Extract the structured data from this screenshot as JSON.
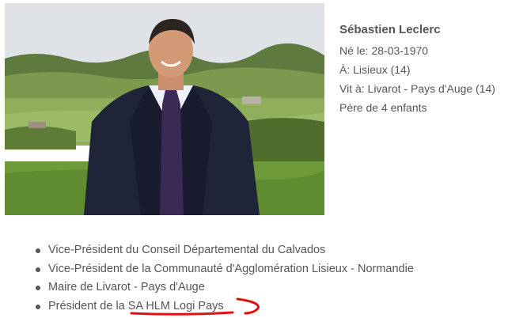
{
  "photo": {
    "alt": "Sébastien Leclerc portrait"
  },
  "bio": {
    "name": "Sébastien Leclerc",
    "born_on": "Né le: 28-03-1970",
    "born_in": "À: Lisieux (14)",
    "lives_in": "Vit à: Livarot - Pays d'Auge (14)",
    "family": "Père de 4 enfants"
  },
  "roles": [
    "Vice-Président du Conseil Départemental du Calvados",
    "Vice-Président de la Communauté d'Agglomération Lisieux - Normandie",
    "Maire de Livarot - Pays d'Auge",
    {
      "prefix": "Président de la ",
      "highlight": "SA HLM Logi Pays"
    }
  ],
  "colors": {
    "text": "#555555",
    "annotation": "#e01010"
  }
}
